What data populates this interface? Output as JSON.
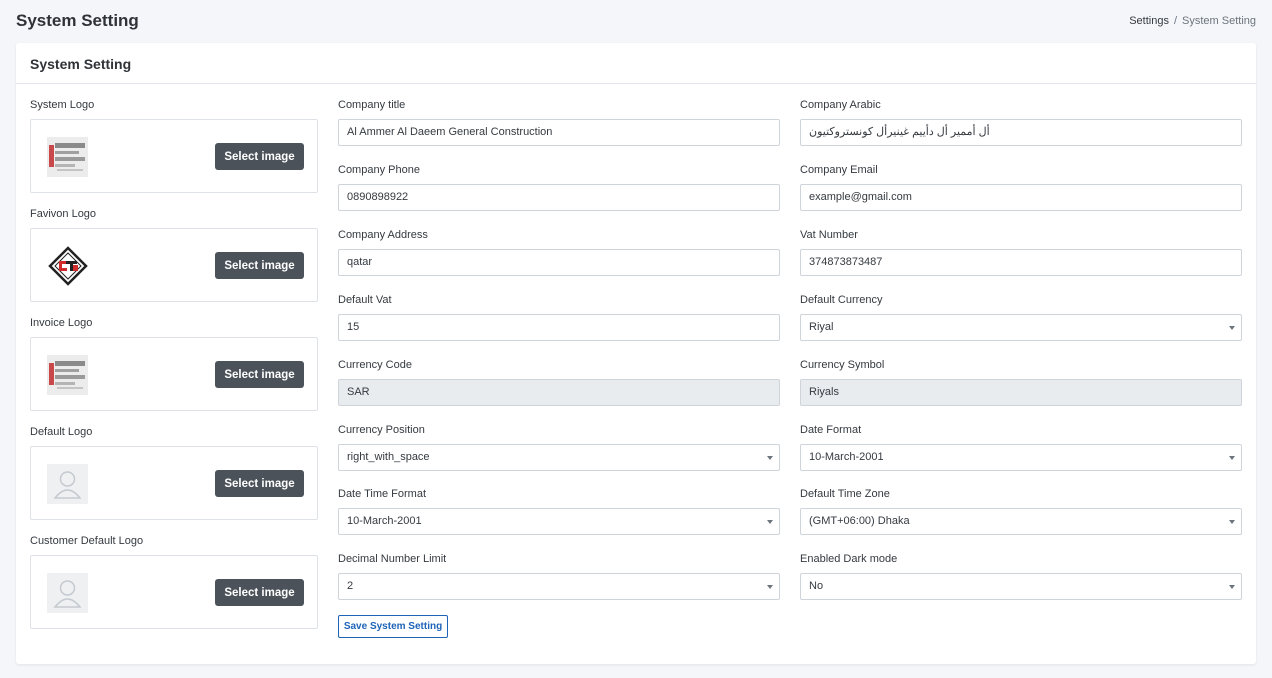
{
  "header": {
    "title": "System Setting",
    "breadcrumb": {
      "parent": "Settings",
      "separator": "/",
      "current": "System Setting"
    }
  },
  "card": {
    "title": "System Setting"
  },
  "logos": [
    {
      "label": "System Logo",
      "button": "Select image",
      "icon": "soft-touch-logo"
    },
    {
      "label": "Favivon Logo",
      "button": "Select image",
      "icon": "sts-favicon"
    },
    {
      "label": "Invoice Logo",
      "button": "Select image",
      "icon": "soft-touch-logo"
    },
    {
      "label": "Default Logo",
      "button": "Select image",
      "icon": "user-placeholder-icon"
    },
    {
      "label": "Customer Default Logo",
      "button": "Select image",
      "icon": "user-placeholder-icon"
    }
  ],
  "fields": {
    "company_title": {
      "label": "Company title",
      "value": "Al Ammer Al Daeem General Construction"
    },
    "company_arabic": {
      "label": "Company Arabic",
      "value": "أل أممير أل دأييم غينيرأل كونستروكتيون"
    },
    "company_phone": {
      "label": "Company Phone",
      "value": "0890898922"
    },
    "company_email": {
      "label": "Company Email",
      "value": "example@gmail.com"
    },
    "company_address": {
      "label": "Company Address",
      "value": "qatar"
    },
    "vat_number": {
      "label": "Vat Number",
      "value": "374873873487"
    },
    "default_vat": {
      "label": "Default Vat",
      "value": "15"
    },
    "default_currency": {
      "label": "Default Currency",
      "value": "Riyal"
    },
    "currency_code": {
      "label": "Currency Code",
      "value": "SAR"
    },
    "currency_symbol": {
      "label": "Currency Symbol",
      "value": "Riyals"
    },
    "currency_position": {
      "label": "Currency Position",
      "value": "right_with_space"
    },
    "date_format": {
      "label": "Date Format",
      "value": "10-March-2001"
    },
    "date_time_format": {
      "label": "Date Time Format",
      "value": "10-March-2001"
    },
    "default_time_zone": {
      "label": "Default Time Zone",
      "value": "(GMT+06:00) Dhaka"
    },
    "decimal_number_limit": {
      "label": "Decimal Number Limit",
      "value": "2"
    },
    "enabled_dark_mode": {
      "label": "Enabled Dark mode",
      "value": "No"
    }
  },
  "save_button": "Save System Setting",
  "colors": {
    "background": "#f5f6fa",
    "select_button": "#4b5259",
    "primary": "#1d63b8",
    "readonly_input": "#e9ecef"
  }
}
